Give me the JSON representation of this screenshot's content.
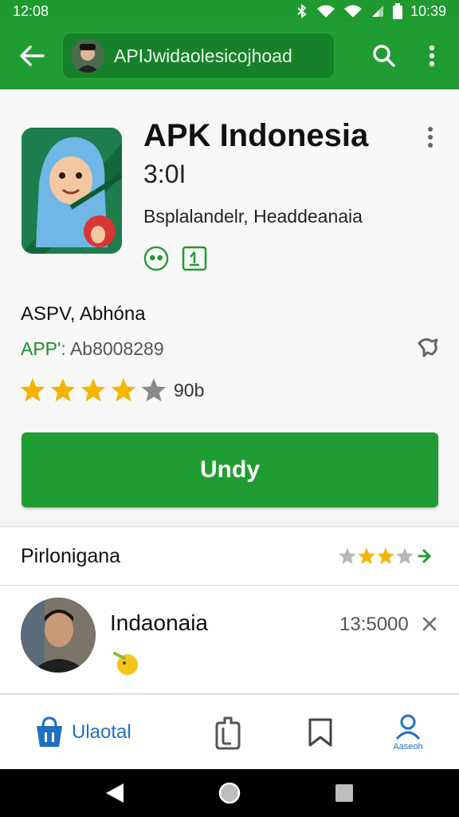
{
  "status_bar": {
    "time": "12:08",
    "right_time": "10:39"
  },
  "app_bar": {
    "url_text": "APIJwidaolesicojhoad"
  },
  "app": {
    "title": "APK Indonesia",
    "version": "3:0I",
    "developer": "Bsplalandelr, Headdeanaia",
    "info_name": "ASPV, Abhóna",
    "apk_prefix": "APP': ",
    "apk_value": "Ab8008289",
    "rating_count": "90b",
    "rating_stars": 4,
    "install_label": "Undy"
  },
  "section": {
    "title": "Pirlonigana",
    "small_rating": 3
  },
  "review": {
    "name": "Indaonaia",
    "value": "13:5000"
  },
  "bottom_nav": {
    "item1_label": "Ulaotal",
    "item4_label": "Aaseoh"
  },
  "colors": {
    "brand_green": "#1f9c32",
    "star_gold": "#f5b400",
    "link_blue": "#1f6fc4"
  }
}
